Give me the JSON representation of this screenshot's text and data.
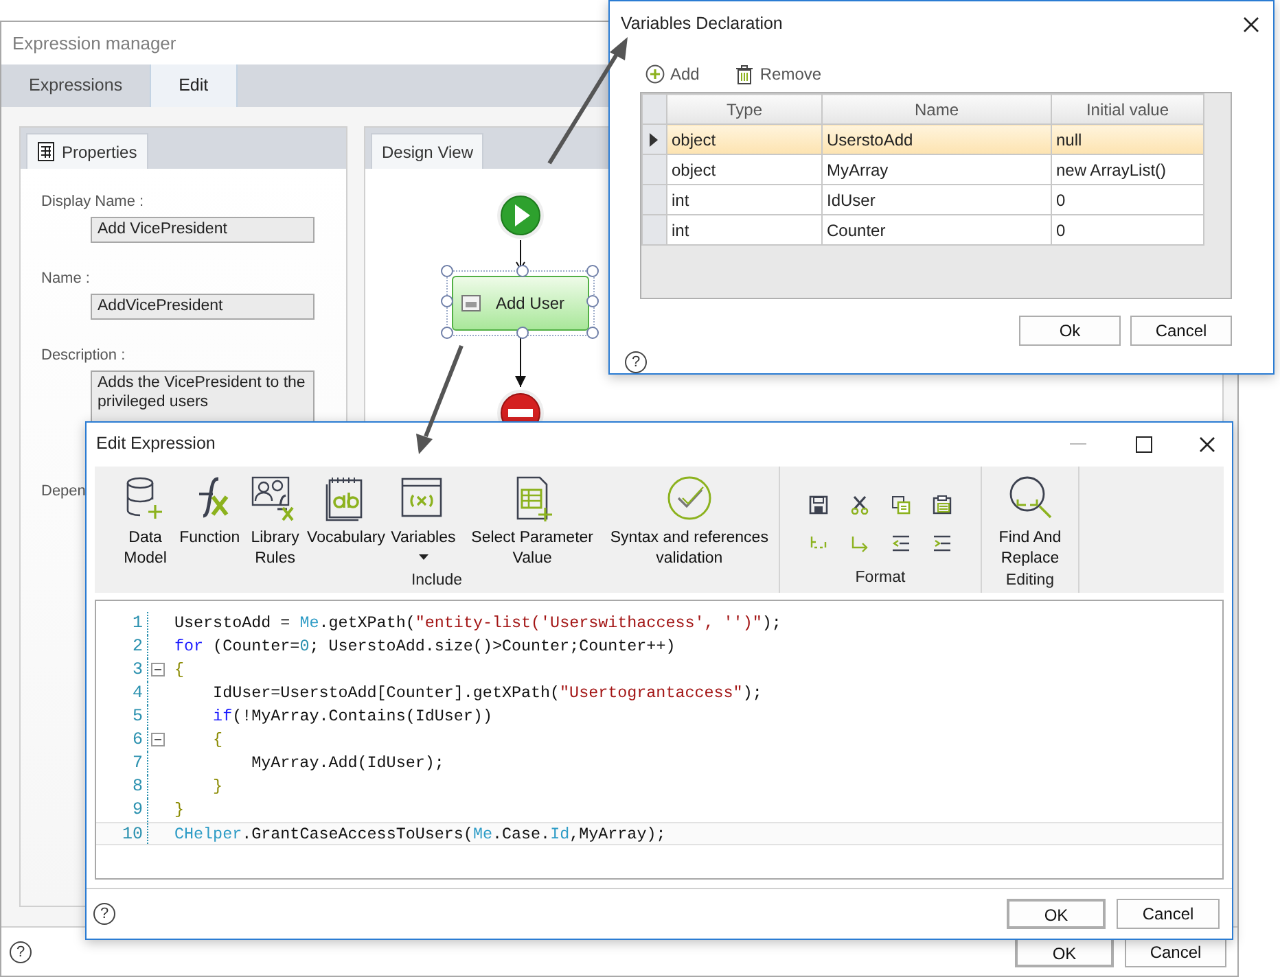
{
  "expression_manager": {
    "title": "Expression manager",
    "tabs": [
      {
        "label": "Expressions",
        "selected": false
      },
      {
        "label": "Edit",
        "selected": true
      }
    ],
    "properties": {
      "tab": "Properties",
      "fields": [
        {
          "label": "Display Name :",
          "value": "Add VicePresident"
        },
        {
          "label": "Name :",
          "value": "AddVicePresident"
        },
        {
          "label": "Description :",
          "value": "Adds the VicePresident to the privileged users"
        },
        {
          "label": "Depen"
        }
      ]
    },
    "design_view": {
      "tab": "Design View",
      "activity": {
        "label": "Add User",
        "selected": true
      }
    },
    "help": "?",
    "buttons": [
      "OK",
      "Cancel"
    ]
  },
  "variables_declaration": {
    "title": "Variables Declaration",
    "toolbar": [
      "Add",
      "Remove"
    ],
    "columns": [
      "Type",
      "Name",
      "Initial value"
    ],
    "rows": [
      {
        "type": "object",
        "name": "UserstoAdd",
        "initial_value": "null",
        "selected": true
      },
      {
        "type": "object",
        "name": "MyArray",
        "initial_value": "new ArrayList()",
        "selected": false
      },
      {
        "type": "int",
        "name": "IdUser",
        "initial_value": "0",
        "selected": false
      },
      {
        "type": "int",
        "name": "Counter",
        "initial_value": "0",
        "selected": false
      }
    ],
    "help": "?",
    "buttons": [
      "Ok",
      "Cancel"
    ]
  },
  "edit_expression": {
    "title": "Edit Expression",
    "ribbon": [
      {
        "label": "Include",
        "buttons": [
          {
            "label": "Data Model",
            "dropdown": false
          },
          {
            "label": "Function",
            "dropdown": false
          },
          {
            "label": "Library Rules",
            "dropdown": false
          },
          {
            "label": "Vocabulary",
            "dropdown": false
          },
          {
            "label": "Variables",
            "dropdown": true
          },
          {
            "label": "Select Parameter Value",
            "dropdown": false
          },
          {
            "label": "Syntax and references validation",
            "dropdown": false
          }
        ]
      },
      {
        "label": "Format"
      },
      {
        "label": "Editing",
        "buttons": [
          {
            "label": "Find And Replace",
            "dropdown": false
          }
        ]
      }
    ],
    "code": [
      {
        "number": "1",
        "fold": false,
        "selected": false,
        "tokens": [
          {
            "kind": "plain",
            "text": "UserstoAdd = "
          },
          {
            "kind": "type",
            "text": "Me"
          },
          {
            "kind": "plain",
            "text": ".getXPath("
          },
          {
            "kind": "string",
            "text": "\"entity-list('Userswithaccess', '')\""
          },
          {
            "kind": "plain",
            "text": ");"
          }
        ]
      },
      {
        "number": "2",
        "fold": false,
        "selected": false,
        "tokens": [
          {
            "kind": "keyword",
            "text": "for"
          },
          {
            "kind": "plain",
            "text": " (Counter="
          },
          {
            "kind": "number",
            "text": "0"
          },
          {
            "kind": "plain",
            "text": "; UserstoAdd.size()>Counter;Counter++)"
          }
        ]
      },
      {
        "number": "3",
        "fold": true,
        "selected": false,
        "tokens": [
          {
            "kind": "bracket",
            "text": "{"
          }
        ]
      },
      {
        "number": "4",
        "fold": false,
        "selected": false,
        "tokens": [
          {
            "kind": "plain",
            "text": "    IdUser=UserstoAdd[Counter].getXPath("
          },
          {
            "kind": "string",
            "text": "\"Usertograntaccess\""
          },
          {
            "kind": "plain",
            "text": ");"
          }
        ]
      },
      {
        "number": "5",
        "fold": false,
        "selected": false,
        "tokens": [
          {
            "kind": "keyword",
            "text": "    if"
          },
          {
            "kind": "plain",
            "text": "(!MyArray.Contains(IdUser))"
          }
        ]
      },
      {
        "number": "6",
        "fold": true,
        "selected": false,
        "tokens": [
          {
            "kind": "bracket",
            "text": "    {"
          }
        ]
      },
      {
        "number": "7",
        "fold": false,
        "selected": false,
        "tokens": [
          {
            "kind": "plain",
            "text": "        MyArray.Add(IdUser);"
          }
        ]
      },
      {
        "number": "8",
        "fold": false,
        "selected": false,
        "tokens": [
          {
            "kind": "bracket",
            "text": "    }"
          }
        ]
      },
      {
        "number": "9",
        "fold": false,
        "selected": false,
        "tokens": [
          {
            "kind": "bracket",
            "text": "}"
          }
        ]
      },
      {
        "number": "10",
        "fold": false,
        "selected": true,
        "tokens": [
          {
            "kind": "type",
            "text": "CHelper"
          },
          {
            "kind": "plain",
            "text": ".GrantCaseAccessToUsers("
          },
          {
            "kind": "type",
            "text": "Me"
          },
          {
            "kind": "plain",
            "text": ".Case."
          },
          {
            "kind": "type",
            "text": "Id"
          },
          {
            "kind": "plain",
            "text": ",MyArray);"
          }
        ]
      }
    ],
    "help": "?",
    "buttons": [
      "OK",
      "Cancel"
    ]
  }
}
